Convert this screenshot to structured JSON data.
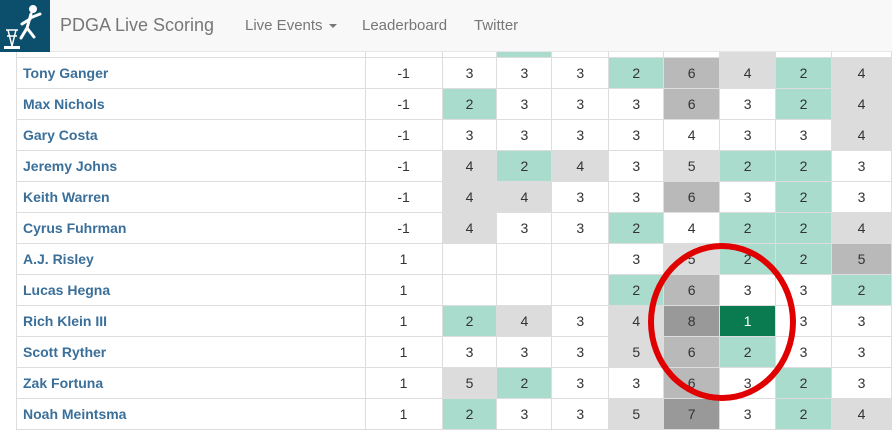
{
  "nav": {
    "brand": "PDGA Live Scoring",
    "live_events": "Live Events",
    "leaderboard": "Leaderboard",
    "twitter": "Twitter"
  },
  "colors": {
    "birdie": "#aadcce",
    "par": "#ffffff",
    "bogey": "#dcdcdc",
    "double_bogey": "#b9b9b9",
    "triple_bogey": "#999999",
    "ace": "#0a7a50",
    "annotation": "#e00000",
    "player_link": "#3a6f9a"
  },
  "rows": [
    {
      "name": "Tony Ganger",
      "total": "-1",
      "holes": [
        {
          "v": "3",
          "c": "par"
        },
        {
          "v": "3",
          "c": "par"
        },
        {
          "v": "3",
          "c": "par"
        },
        {
          "v": "2",
          "c": "birdie"
        },
        {
          "v": "6",
          "c": "double"
        },
        {
          "v": "4",
          "c": "bogey"
        },
        {
          "v": "2",
          "c": "birdie"
        },
        {
          "v": "4",
          "c": "bogey"
        }
      ]
    },
    {
      "name": "Max Nichols",
      "total": "-1",
      "holes": [
        {
          "v": "2",
          "c": "birdie"
        },
        {
          "v": "3",
          "c": "par"
        },
        {
          "v": "3",
          "c": "par"
        },
        {
          "v": "3",
          "c": "par"
        },
        {
          "v": "6",
          "c": "double"
        },
        {
          "v": "3",
          "c": "par"
        },
        {
          "v": "2",
          "c": "birdie"
        },
        {
          "v": "4",
          "c": "bogey"
        }
      ]
    },
    {
      "name": "Gary Costa",
      "total": "-1",
      "holes": [
        {
          "v": "3",
          "c": "par"
        },
        {
          "v": "3",
          "c": "par"
        },
        {
          "v": "3",
          "c": "par"
        },
        {
          "v": "3",
          "c": "par"
        },
        {
          "v": "4",
          "c": "par"
        },
        {
          "v": "3",
          "c": "par"
        },
        {
          "v": "3",
          "c": "par"
        },
        {
          "v": "4",
          "c": "bogey"
        }
      ]
    },
    {
      "name": "Jeremy Johns",
      "total": "-1",
      "holes": [
        {
          "v": "4",
          "c": "bogey"
        },
        {
          "v": "2",
          "c": "birdie"
        },
        {
          "v": "4",
          "c": "bogey"
        },
        {
          "v": "3",
          "c": "par"
        },
        {
          "v": "5",
          "c": "bogey"
        },
        {
          "v": "2",
          "c": "birdie"
        },
        {
          "v": "2",
          "c": "birdie"
        },
        {
          "v": "3",
          "c": "par"
        }
      ]
    },
    {
      "name": "Keith Warren",
      "total": "-1",
      "holes": [
        {
          "v": "4",
          "c": "bogey"
        },
        {
          "v": "4",
          "c": "bogey"
        },
        {
          "v": "3",
          "c": "par"
        },
        {
          "v": "3",
          "c": "par"
        },
        {
          "v": "6",
          "c": "double"
        },
        {
          "v": "3",
          "c": "par"
        },
        {
          "v": "2",
          "c": "birdie"
        },
        {
          "v": "3",
          "c": "par"
        }
      ]
    },
    {
      "name": "Cyrus Fuhrman",
      "total": "-1",
      "holes": [
        {
          "v": "4",
          "c": "bogey"
        },
        {
          "v": "3",
          "c": "par"
        },
        {
          "v": "3",
          "c": "par"
        },
        {
          "v": "2",
          "c": "birdie"
        },
        {
          "v": "4",
          "c": "par"
        },
        {
          "v": "2",
          "c": "birdie"
        },
        {
          "v": "2",
          "c": "birdie"
        },
        {
          "v": "4",
          "c": "bogey"
        }
      ]
    },
    {
      "name": "A.J. Risley",
      "total": "1",
      "holes": [
        {
          "v": "",
          "c": "empty"
        },
        {
          "v": "",
          "c": "empty"
        },
        {
          "v": "",
          "c": "empty"
        },
        {
          "v": "3",
          "c": "par"
        },
        {
          "v": "5",
          "c": "bogey"
        },
        {
          "v": "2",
          "c": "birdie"
        },
        {
          "v": "2",
          "c": "birdie"
        },
        {
          "v": "5",
          "c": "double"
        }
      ]
    },
    {
      "name": "Lucas Hegna",
      "total": "1",
      "holes": [
        {
          "v": "",
          "c": "empty"
        },
        {
          "v": "",
          "c": "empty"
        },
        {
          "v": "",
          "c": "empty"
        },
        {
          "v": "2",
          "c": "birdie"
        },
        {
          "v": "6",
          "c": "double"
        },
        {
          "v": "3",
          "c": "par"
        },
        {
          "v": "3",
          "c": "par"
        },
        {
          "v": "2",
          "c": "birdie"
        }
      ]
    },
    {
      "name": "Rich Klein III",
      "total": "1",
      "holes": [
        {
          "v": "2",
          "c": "birdie"
        },
        {
          "v": "4",
          "c": "bogey"
        },
        {
          "v": "3",
          "c": "par"
        },
        {
          "v": "4",
          "c": "bogey"
        },
        {
          "v": "8",
          "c": "triple"
        },
        {
          "v": "1",
          "c": "ace"
        },
        {
          "v": "3",
          "c": "par"
        },
        {
          "v": "3",
          "c": "par"
        }
      ]
    },
    {
      "name": "Scott Ryther",
      "total": "1",
      "holes": [
        {
          "v": "3",
          "c": "par"
        },
        {
          "v": "3",
          "c": "par"
        },
        {
          "v": "3",
          "c": "par"
        },
        {
          "v": "5",
          "c": "bogey"
        },
        {
          "v": "6",
          "c": "double"
        },
        {
          "v": "2",
          "c": "birdie"
        },
        {
          "v": "3",
          "c": "par"
        },
        {
          "v": "3",
          "c": "par"
        }
      ]
    },
    {
      "name": "Zak Fortuna",
      "total": "1",
      "holes": [
        {
          "v": "5",
          "c": "bogey"
        },
        {
          "v": "2",
          "c": "birdie"
        },
        {
          "v": "3",
          "c": "par"
        },
        {
          "v": "3",
          "c": "par"
        },
        {
          "v": "6",
          "c": "double"
        },
        {
          "v": "3",
          "c": "par"
        },
        {
          "v": "2",
          "c": "birdie"
        },
        {
          "v": "3",
          "c": "par"
        }
      ]
    },
    {
      "name": "Noah Meintsma",
      "total": "1",
      "holes": [
        {
          "v": "2",
          "c": "birdie"
        },
        {
          "v": "3",
          "c": "par"
        },
        {
          "v": "3",
          "c": "par"
        },
        {
          "v": "5",
          "c": "bogey"
        },
        {
          "v": "7",
          "c": "triple"
        },
        {
          "v": "3",
          "c": "par"
        },
        {
          "v": "2",
          "c": "birdie"
        },
        {
          "v": "4",
          "c": "bogey"
        }
      ]
    }
  ]
}
